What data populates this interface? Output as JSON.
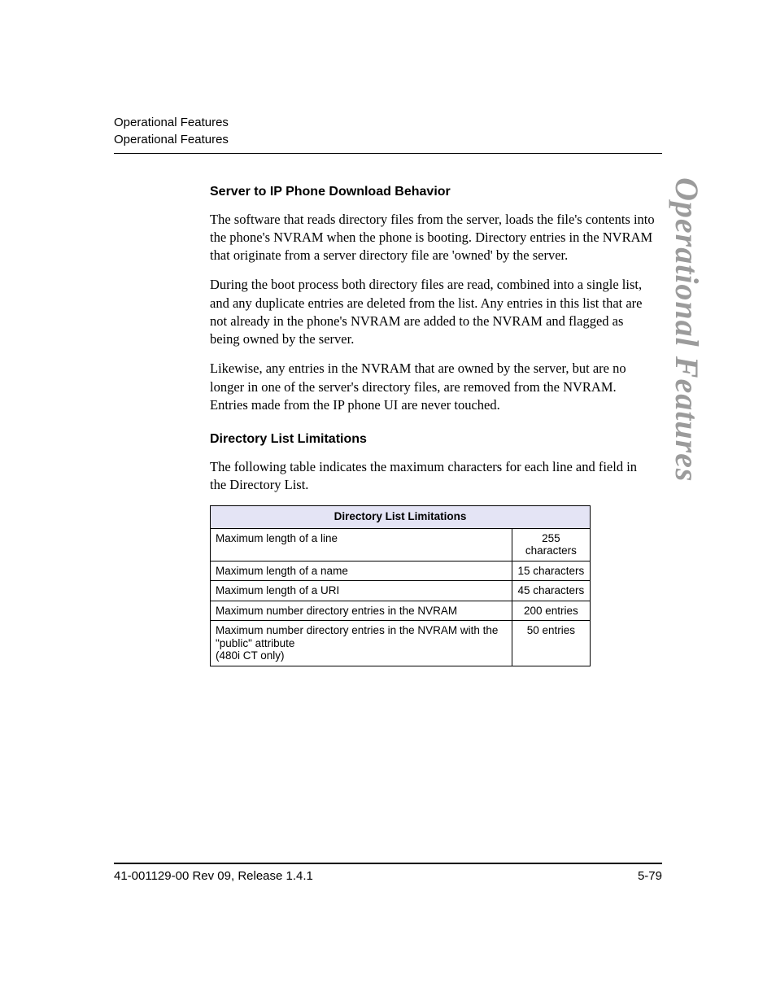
{
  "header": {
    "line1": "Operational Features",
    "line2": "Operational Features"
  },
  "side_tab": "Operational Features",
  "section1": {
    "heading": "Server to IP Phone Download Behavior",
    "p1": "The software that reads directory files from the server, loads the file's contents into the phone's NVRAM when the phone is booting. Directory entries in the NVRAM that originate from a server directory file are 'owned' by the server.",
    "p2": "During the boot process both directory files are read, combined into a single list, and any duplicate entries are deleted from the list. Any entries in this list that are not already in the phone's NVRAM are added to the NVRAM and flagged as being owned by the server.",
    "p3": "Likewise, any entries in the NVRAM that are owned by the server, but are no longer in one of the server's directory files, are removed from the NVRAM. Entries made from the IP phone UI are never touched."
  },
  "section2": {
    "heading": "Directory List Limitations",
    "intro": "The following table indicates the maximum characters for each line and field in the Directory List."
  },
  "table": {
    "title": "Directory List Limitations",
    "rows": [
      {
        "label": "Maximum length of a line",
        "value": "255 characters"
      },
      {
        "label": "Maximum length of a name",
        "value": "15 characters"
      },
      {
        "label": "Maximum length of a URI",
        "value": "45 characters"
      },
      {
        "label": "Maximum number directory entries in the NVRAM",
        "value": "200 entries"
      },
      {
        "label": "Maximum number directory entries in the NVRAM with the \"public\" attribute\n(480i CT only)",
        "value": "50 entries"
      }
    ]
  },
  "footer": {
    "left": "41-001129-00 Rev 09, Release 1.4.1",
    "right": "5-79"
  }
}
